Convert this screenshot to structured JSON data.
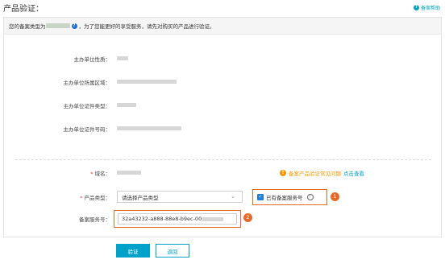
{
  "header": {
    "title": "产品验证：",
    "help_label": "备案帮助",
    "help_icon": "question-circle-icon"
  },
  "panel": {
    "notice_prefix": "您的备案类型为",
    "notice_suffix": "，为了您能更好的享受服务，请先对购买的产品进行验证。"
  },
  "info_rows": [
    {
      "label": "主办单位性质："
    },
    {
      "label": "主办单位所属区域："
    },
    {
      "label": "主办单位证件类型："
    },
    {
      "label": "主办单位证件号码："
    }
  ],
  "domain_row": {
    "required_mark": "*",
    "label": "域名："
  },
  "faq": {
    "icon": "warning-circle-icon",
    "text": "备案产品验证常见问题",
    "link": "点击查看"
  },
  "product_row": {
    "required_mark": "*",
    "label": "产品类型：",
    "select_value": "请选择产品类型",
    "chevron_icon": "chevron-down-icon"
  },
  "has_service_checkbox": {
    "checked": true,
    "label": "已有备案服务号",
    "info_icon": "info-circle-icon"
  },
  "service_row": {
    "label": "备案服务号：",
    "value": "32a43232-a888-88e8-b9ec-00"
  },
  "badges": {
    "first": "1",
    "second": "2"
  },
  "buttons": {
    "verify": "验证",
    "back": "返回"
  },
  "colors": {
    "accent": "#00a2ca",
    "highlight": "#e86a2b",
    "warning": "#f39800",
    "checkbox": "#1f7fd9"
  }
}
